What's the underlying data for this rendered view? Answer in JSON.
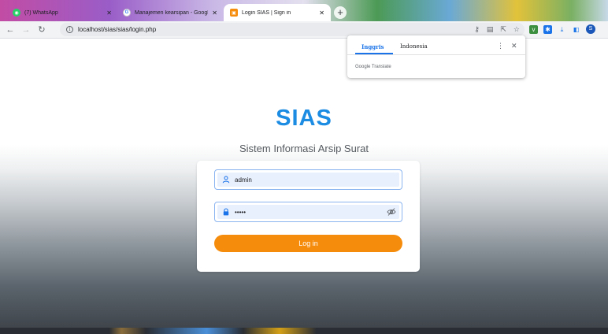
{
  "browser": {
    "tabs": [
      {
        "title": "(7) WhatsApp",
        "favicon": "whatsapp-icon",
        "color": "#25d366",
        "active": false
      },
      {
        "title": "Manajemen kearsipan - Google S...",
        "favicon": "google-icon",
        "color": "#4285f4",
        "active": false
      },
      {
        "title": "Login SIAS | Sign in",
        "favicon": "sias-icon",
        "color": "#f68c0c",
        "active": true
      }
    ],
    "new_tab_label": "+",
    "url": "localhost/sias/sias/login.php",
    "profile_initial": "S"
  },
  "translate_popup": {
    "languages": [
      "Inggris",
      "Indonesia"
    ],
    "selected": "Inggris",
    "footer": "Google Translate"
  },
  "page": {
    "brand": "SIAS",
    "subtitle": "Sistem Informasi Arsip Surat",
    "form": {
      "username_value": "admin",
      "password_value": "•••••",
      "submit_label": "Log in"
    }
  },
  "colors": {
    "brand": "#1c8ce3",
    "button": "#f68c0c",
    "field_fill": "#e8f0fe",
    "field_border": "#8ab4f0"
  }
}
